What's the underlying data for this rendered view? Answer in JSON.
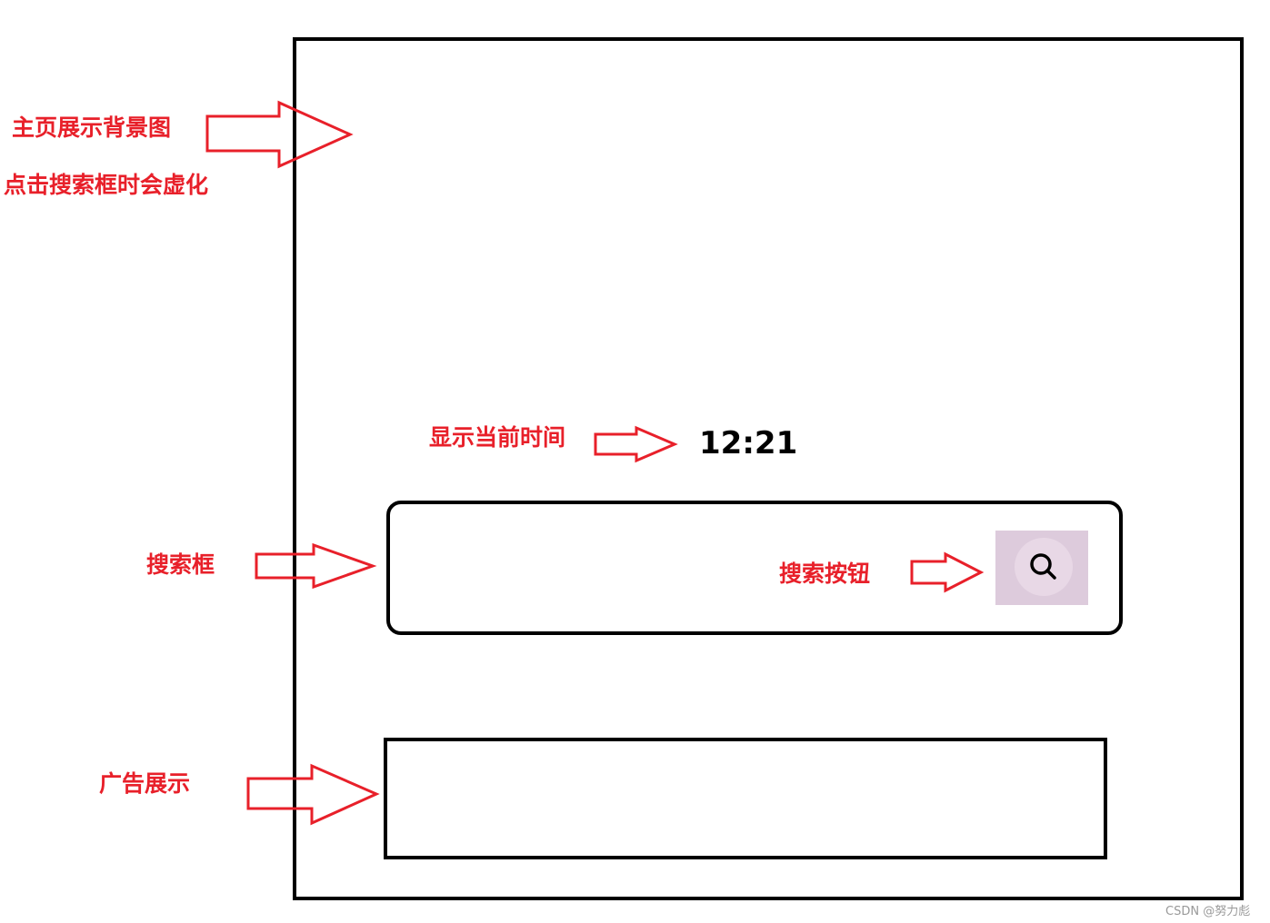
{
  "annotations": {
    "background": "主页展示背景图",
    "blur": "点击搜索框时会虚化",
    "time": "显示当前时间",
    "search_box": "搜索框",
    "search_button": "搜索按钮",
    "ad": "广告展示"
  },
  "clock": {
    "time": "12:21"
  },
  "icons": {
    "search": "search-icon"
  },
  "colors": {
    "annotation": "#e8202a",
    "button_bg": "#ddcbdc"
  },
  "watermark": "CSDN @努力彪"
}
